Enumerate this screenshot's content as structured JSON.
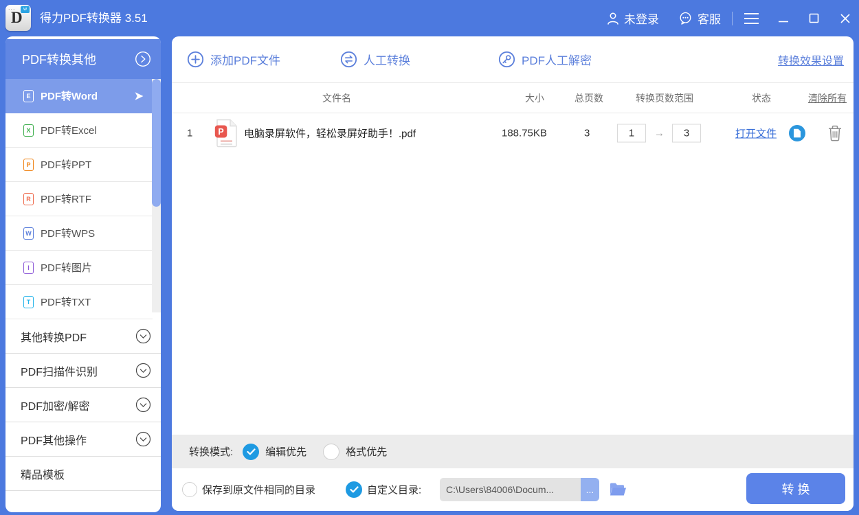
{
  "titlebar": {
    "app_title": "得力PDF转换器 3.51",
    "account": "未登录",
    "support": "客服"
  },
  "sidebar": {
    "header": "PDF转换其他",
    "items": [
      {
        "label": "PDF转Word",
        "icon_letter": "E",
        "color": "#ffffff",
        "selected": true
      },
      {
        "label": "PDF转Excel",
        "icon_letter": "X",
        "color": "#3faf4e",
        "selected": false
      },
      {
        "label": "PDF转PPT",
        "icon_letter": "P",
        "color": "#f08519",
        "selected": false
      },
      {
        "label": "PDF转RTF",
        "icon_letter": "R",
        "color": "#ef6c4e",
        "selected": false
      },
      {
        "label": "PDF转WPS",
        "icon_letter": "W",
        "color": "#5b7fdb",
        "selected": false
      },
      {
        "label": "PDF转图片",
        "icon_letter": "I",
        "color": "#8e5bd8",
        "selected": false
      },
      {
        "label": "PDF转TXT",
        "icon_letter": "T",
        "color": "#27b5ea",
        "selected": false
      }
    ],
    "sections": [
      {
        "label": "其他转换PDF"
      },
      {
        "label": "PDF扫描件识别"
      },
      {
        "label": "PDF加密/解密"
      },
      {
        "label": "PDF其他操作"
      },
      {
        "label": "精品模板"
      }
    ]
  },
  "toolbar": {
    "add_label": "添加PDF文件",
    "manual_label": "人工转换",
    "decrypt_label": "PDF人工解密",
    "settings_label": "转换效果设置"
  },
  "table": {
    "col_filename": "文件名",
    "col_size": "大小",
    "col_pages": "总页数",
    "col_range": "转换页数范围",
    "col_status": "状态",
    "clear_all": "清除所有",
    "rows": [
      {
        "index": "1",
        "filename": "电脑录屏软件，轻松录屏好助手！.pdf",
        "size": "188.75KB",
        "pages": "3",
        "range_from": "1",
        "range_to": "3",
        "range_arrow": "→",
        "status_link": "打开文件"
      }
    ]
  },
  "mode": {
    "label": "转换模式:",
    "option1": "编辑优先",
    "option2": "格式优先",
    "selected": "编辑优先"
  },
  "output": {
    "same_dir_label": "保存到原文件相同的目录",
    "custom_label": "自定义目录:",
    "path": "C:\\Users\\84006\\Docum...",
    "browse_label": "...",
    "convert_label": "转 换",
    "selected": "自定义目录"
  },
  "icons": {
    "app": "deli-d-logo",
    "user": "person-icon",
    "support": "chat-bubble-icon",
    "menu": "hamburger-icon",
    "minimize": "minimize-icon",
    "maximize": "maximize-icon",
    "close": "close-icon",
    "add": "plus-circle-icon",
    "manual": "swap-arrows-circle-icon",
    "decrypt": "key-circle-icon",
    "row_file": "pdf-file-icon",
    "open": "file-circle-icon",
    "delete": "trash-icon",
    "browse_folder": "folder-icon",
    "accent_color": "#5b7fdb",
    "checked_color": "#1e9ae2"
  }
}
